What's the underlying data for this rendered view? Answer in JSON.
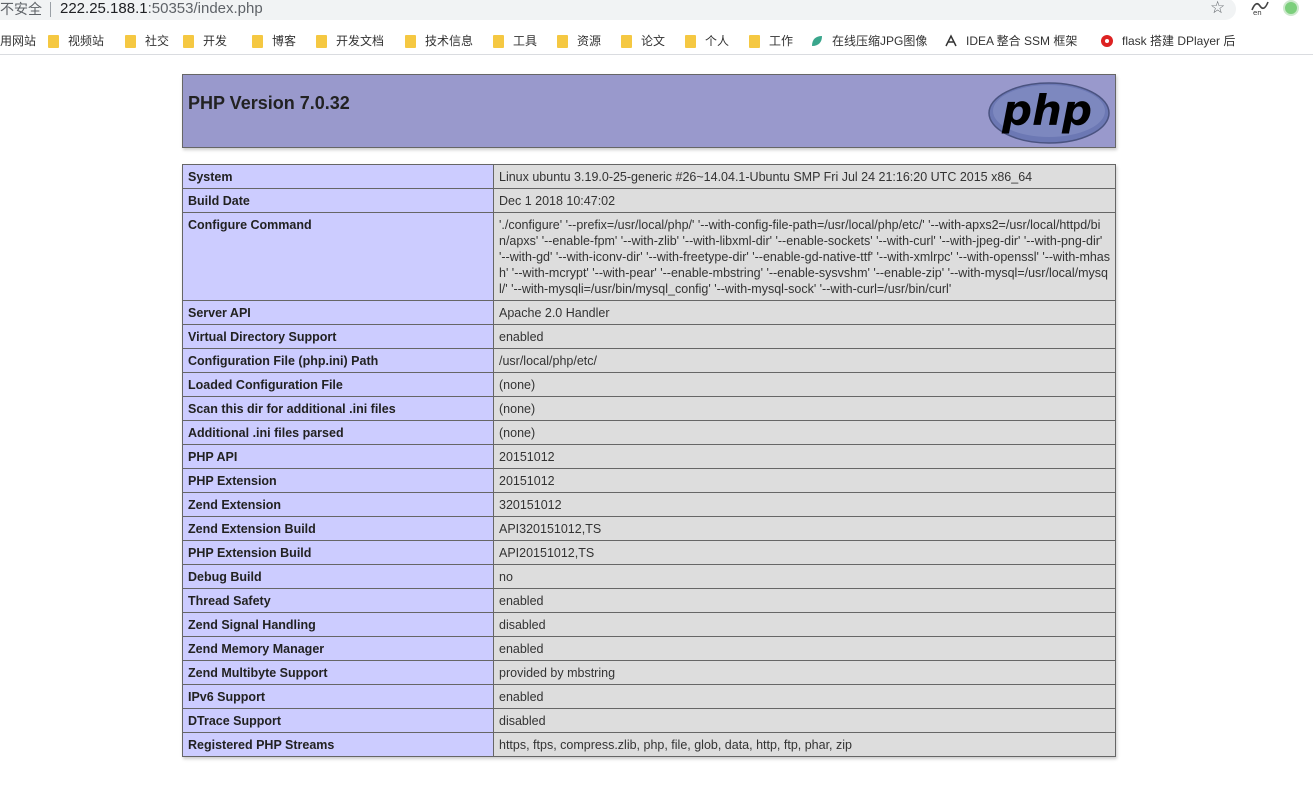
{
  "browser": {
    "insecure_label": "不安全",
    "url_host": "222.25.188.1",
    "url_rest": ":50353/index.php",
    "star_icon": "star-icon",
    "bookmarks": [
      {
        "label": "用网站",
        "icon": "none"
      },
      {
        "label": "视频站",
        "icon": "folder-icon"
      },
      {
        "label": "社交",
        "icon": "folder-icon"
      },
      {
        "label": "开发",
        "icon": "folder-icon"
      },
      {
        "label": "博客",
        "icon": "folder-icon"
      },
      {
        "label": "开发文档",
        "icon": "folder-icon"
      },
      {
        "label": "技术信息",
        "icon": "folder-icon"
      },
      {
        "label": "工具",
        "icon": "folder-icon"
      },
      {
        "label": "资源",
        "icon": "folder-icon"
      },
      {
        "label": "论文",
        "icon": "folder-icon"
      },
      {
        "label": "个人",
        "icon": "folder-icon"
      },
      {
        "label": "工作",
        "icon": "folder-icon"
      },
      {
        "label": "在线压缩JPG图像",
        "icon": "leaf-icon"
      },
      {
        "label": "IDEA 整合 SSM 框架",
        "icon": "idea-icon"
      },
      {
        "label": "flask 搭建 DPlayer 后",
        "icon": "huawei-icon"
      }
    ]
  },
  "phpinfo": {
    "title": "PHP Version 7.0.32",
    "logo_text": "php",
    "colors": {
      "header": "#9999cc",
      "key": "#ccccff",
      "value": "#dddddd"
    },
    "rows": [
      {
        "key": "System",
        "value": "Linux ubuntu 3.19.0-25-generic #26~14.04.1-Ubuntu SMP Fri Jul 24 21:16:20 UTC 2015 x86_64"
      },
      {
        "key": "Build Date",
        "value": "Dec 1 2018 10:47:02"
      },
      {
        "key": "Configure Command",
        "value": "'./configure' '--prefix=/usr/local/php/' '--with-config-file-path=/usr/local/php/etc/' '--with-apxs2=/usr/local/httpd/bin/apxs' '--enable-fpm' '--with-zlib' '--with-libxml-dir' '--enable-sockets' '--with-curl' '--with-jpeg-dir' '--with-png-dir' '--with-gd' '--with-iconv-dir' '--with-freetype-dir' '--enable-gd-native-ttf' '--with-xmlrpc' '--with-openssl' '--with-mhash' '--with-mcrypt' '--with-pear' '--enable-mbstring' '--enable-sysvshm' '--enable-zip' '--with-mysql=/usr/local/mysql/' '--with-mysqli=/usr/bin/mysql_config' '--with-mysql-sock' '--with-curl=/usr/bin/curl'"
      },
      {
        "key": "Server API",
        "value": "Apache 2.0 Handler"
      },
      {
        "key": "Virtual Directory Support",
        "value": "enabled"
      },
      {
        "key": "Configuration File (php.ini) Path",
        "value": "/usr/local/php/etc/"
      },
      {
        "key": "Loaded Configuration File",
        "value": "(none)"
      },
      {
        "key": "Scan this dir for additional .ini files",
        "value": "(none)"
      },
      {
        "key": "Additional .ini files parsed",
        "value": "(none)"
      },
      {
        "key": "PHP API",
        "value": "20151012"
      },
      {
        "key": "PHP Extension",
        "value": "20151012"
      },
      {
        "key": "Zend Extension",
        "value": "320151012"
      },
      {
        "key": "Zend Extension Build",
        "value": "API320151012,TS"
      },
      {
        "key": "PHP Extension Build",
        "value": "API20151012,TS"
      },
      {
        "key": "Debug Build",
        "value": "no"
      },
      {
        "key": "Thread Safety",
        "value": "enabled"
      },
      {
        "key": "Zend Signal Handling",
        "value": "disabled"
      },
      {
        "key": "Zend Memory Manager",
        "value": "enabled"
      },
      {
        "key": "Zend Multibyte Support",
        "value": "provided by mbstring"
      },
      {
        "key": "IPv6 Support",
        "value": "enabled"
      },
      {
        "key": "DTrace Support",
        "value": "disabled"
      },
      {
        "key": "Registered PHP Streams",
        "value": "https, ftps, compress.zlib, php, file, glob, data, http, ftp, phar, zip"
      }
    ]
  }
}
